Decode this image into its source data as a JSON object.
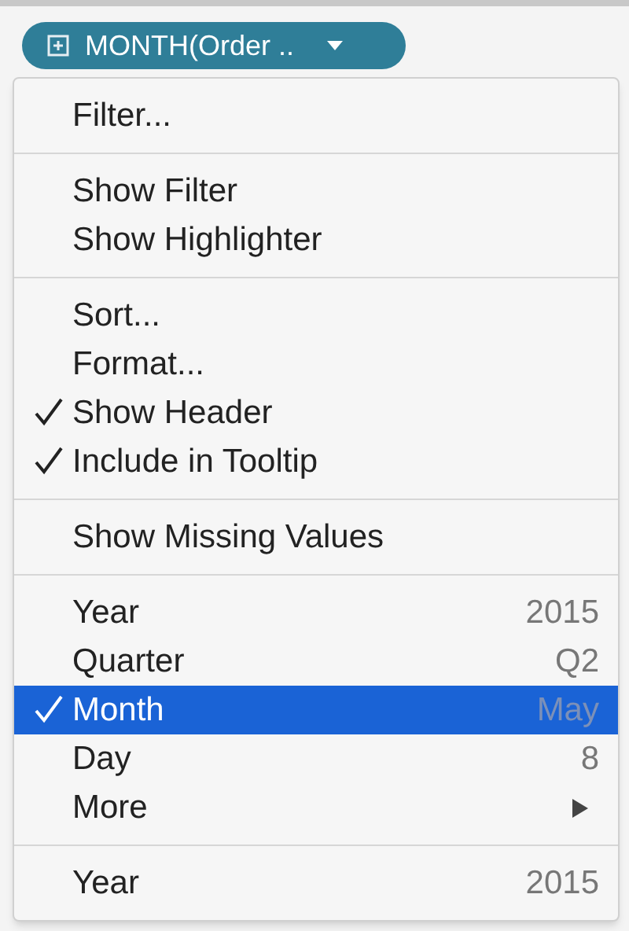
{
  "pill": {
    "label": "MONTH(Order .."
  },
  "menu": {
    "sections": [
      {
        "items": [
          {
            "label": "Filter...",
            "kind": "plain",
            "checked": false,
            "selected": false
          }
        ]
      },
      {
        "items": [
          {
            "label": "Show Filter",
            "kind": "plain",
            "checked": false,
            "selected": false
          },
          {
            "label": "Show Highlighter",
            "kind": "plain",
            "checked": false,
            "selected": false
          }
        ]
      },
      {
        "items": [
          {
            "label": "Sort...",
            "kind": "plain",
            "checked": false,
            "selected": false
          },
          {
            "label": "Format...",
            "kind": "plain",
            "checked": false,
            "selected": false
          },
          {
            "label": "Show Header",
            "kind": "plain",
            "checked": true,
            "selected": false
          },
          {
            "label": "Include in Tooltip",
            "kind": "plain",
            "checked": true,
            "selected": false
          }
        ]
      },
      {
        "items": [
          {
            "label": "Show Missing Values",
            "kind": "plain",
            "checked": false,
            "selected": false
          }
        ]
      },
      {
        "items": [
          {
            "label": "Year",
            "kind": "plain",
            "detail": "2015",
            "checked": false,
            "selected": false
          },
          {
            "label": "Quarter",
            "kind": "plain",
            "detail": "Q2",
            "checked": false,
            "selected": false
          },
          {
            "label": "Month",
            "kind": "plain",
            "detail": "May",
            "checked": true,
            "selected": true
          },
          {
            "label": "Day",
            "kind": "plain",
            "detail": "8",
            "checked": false,
            "selected": false
          },
          {
            "label": "More",
            "kind": "submenu",
            "checked": false,
            "selected": false
          }
        ]
      },
      {
        "items": [
          {
            "label": "Year",
            "kind": "plain",
            "detail": "2015",
            "checked": false,
            "selected": false
          }
        ]
      }
    ]
  }
}
